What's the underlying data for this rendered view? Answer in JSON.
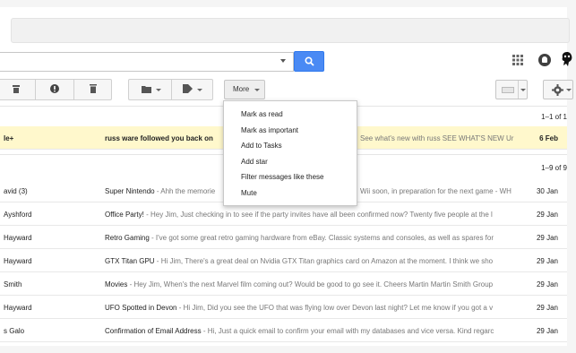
{
  "search": {
    "placeholder": ""
  },
  "toolbar": {
    "more_label": "More"
  },
  "icons": {
    "archive": "archive-icon",
    "spam": "report-spam-icon",
    "delete": "trash-icon",
    "move": "folder-icon",
    "labels": "tag-icon",
    "search": "search-icon",
    "apps": "apps-grid-icon",
    "notifications": "notifications-icon",
    "avatar": "avatar",
    "keyboard": "keyboard-icon",
    "settings": "gear-icon"
  },
  "colors": {
    "search_button": "#4a8af4",
    "highlight_row": "#fff8cc"
  },
  "section1": {
    "count": "1–1 of 1"
  },
  "section2": {
    "count": "1–9 of 9"
  },
  "highlighted_email": {
    "sender": "le+",
    "subject": "russ ware followed you back on",
    "snippet": "See what's new with russ SEE WHAT'S NEW Ur",
    "date": "6 Feb"
  },
  "emails": [
    {
      "sender": "avid (3)",
      "subject": "Super Nintendo",
      "snippet": " - Ahh the memorie",
      "snippet2": "Wii soon, in preparation for the next game - WH",
      "date": "30 Jan"
    },
    {
      "sender": "Ayshford",
      "subject": "Office Party!",
      "snippet": " - Hey Jim, Just checking in to see if the party invites have all been confirmed now? Twenty five people at the l",
      "date": "29 Jan"
    },
    {
      "sender": "Hayward",
      "subject": "Retro Gaming",
      "snippet": " - I've got some great retro gaming hardware from eBay. Classic systems and consoles, as well as spares for",
      "date": "29 Jan"
    },
    {
      "sender": "Hayward",
      "subject": "GTX Titan GPU",
      "snippet": " - Hi Jim, There's a great deal on Nvidia GTX Titan graphics card on Amazon at the moment. I think we sho",
      "date": "29 Jan"
    },
    {
      "sender": "Smith",
      "subject": "Movies",
      "snippet": " - Hey Jim, When's the next Marvel film coming out? Would be good to go see it. Cheers Martin Martin Smith Group",
      "date": "29 Jan"
    },
    {
      "sender": "Hayward",
      "subject": "UFO Spotted in Devon",
      "snippet": " - Hi Jim, Did you see the UFO that was flying low over Devon last night? Let me know if you got a v",
      "date": "29 Jan"
    },
    {
      "sender": "s Galo",
      "subject": "Confirmation of Email Address",
      "snippet": " - Hi, Just a quick email to confirm your email with my databases and vice versa. Kind regarc",
      "date": "29 Jan"
    }
  ],
  "more_menu": {
    "items": [
      "Mark as read",
      "Mark as important",
      "Add to Tasks",
      "Add star",
      "Filter messages like these",
      "Mute"
    ]
  }
}
